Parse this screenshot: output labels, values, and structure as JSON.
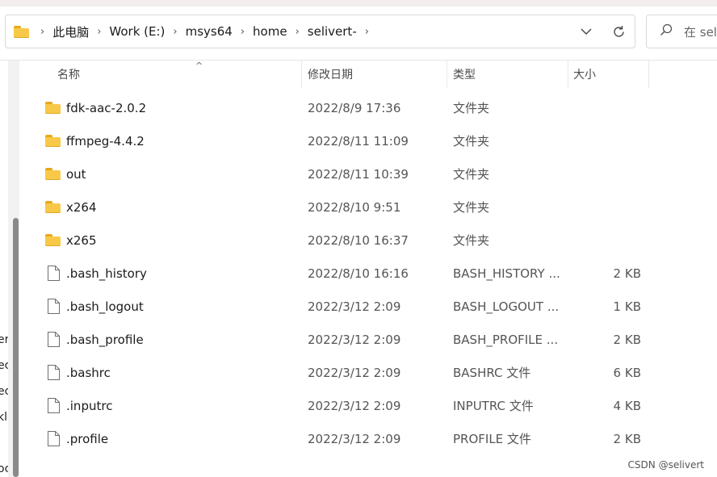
{
  "address_bar": {
    "breadcrumbs": [
      "此电脑",
      "Work (E:)",
      "msys64",
      "home",
      "selivert-"
    ],
    "folder_icon": "folder-icon",
    "dropdown_icon": "chevron-down-icon",
    "refresh_icon": "refresh-icon"
  },
  "search": {
    "placeholder": "在 sel"
  },
  "columns": {
    "name": "名称",
    "date": "修改日期",
    "type": "类型",
    "size": "大小"
  },
  "files": [
    {
      "name": "fdk-aac-2.0.2",
      "date": "2022/8/9 17:36",
      "type": "文件夹",
      "size": "",
      "icon": "folder-icon"
    },
    {
      "name": "ffmpeg-4.4.2",
      "date": "2022/8/11 11:09",
      "type": "文件夹",
      "size": "",
      "icon": "folder-icon"
    },
    {
      "name": "out",
      "date": "2022/8/11 10:39",
      "type": "文件夹",
      "size": "",
      "icon": "folder-icon"
    },
    {
      "name": "x264",
      "date": "2022/8/10 9:51",
      "type": "文件夹",
      "size": "",
      "icon": "folder-icon"
    },
    {
      "name": "x265",
      "date": "2022/8/10 16:37",
      "type": "文件夹",
      "size": "",
      "icon": "folder-icon"
    },
    {
      "name": ".bash_history",
      "date": "2022/8/10 16:16",
      "type": "BASH_HISTORY ...",
      "size": "2 KB",
      "icon": "file-icon"
    },
    {
      "name": ".bash_logout",
      "date": "2022/3/12 2:09",
      "type": "BASH_LOGOUT ...",
      "size": "1 KB",
      "icon": "file-icon"
    },
    {
      "name": ".bash_profile",
      "date": "2022/3/12 2:09",
      "type": "BASH_PROFILE ...",
      "size": "2 KB",
      "icon": "file-icon"
    },
    {
      "name": ".bashrc",
      "date": "2022/3/12 2:09",
      "type": "BASHRC 文件",
      "size": "6 KB",
      "icon": "file-icon"
    },
    {
      "name": ".inputrc",
      "date": "2022/3/12 2:09",
      "type": "INPUTRC 文件",
      "size": "4 KB",
      "icon": "file-icon"
    },
    {
      "name": ".profile",
      "date": "2022/3/12 2:09",
      "type": "PROFILE 文件",
      "size": "2 KB",
      "icon": "file-icon"
    }
  ],
  "left_pane_fragments": [
    "er",
    "ec",
    "ec",
    "kl",
    "oc"
  ],
  "watermark": "CSDN @selivert",
  "colors": {
    "folder": "#f8c948",
    "folder_tab": "#e8a818",
    "scroll_thumb": "#8a8a8a"
  }
}
